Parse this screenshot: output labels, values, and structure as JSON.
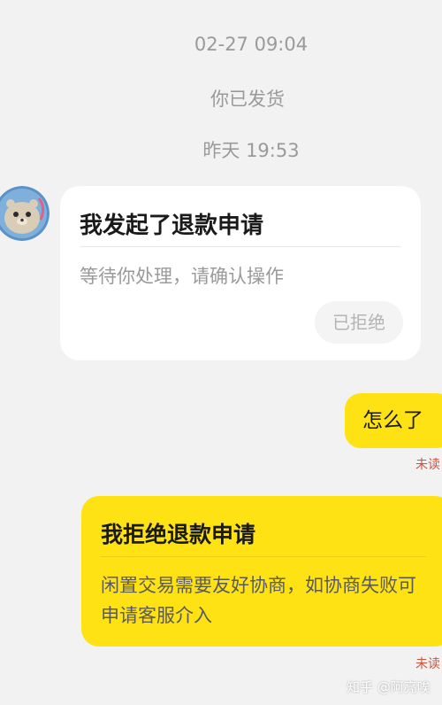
{
  "timestamps": [
    "02-27 09:04",
    "你已发货",
    "昨天 19:53"
  ],
  "refund_card": {
    "title": "我发起了退款申请",
    "subtitle": "等待你处理，请确认操作",
    "status": "已拒绝"
  },
  "message": {
    "text": "怎么了",
    "read_status": "未读"
  },
  "reject_card": {
    "title": "我拒绝退款申请",
    "body": "闲置交易需要友好协商，如协商失败可申请客服介入",
    "read_status": "未读"
  },
  "watermark": "知乎 @阿亮唉",
  "colors": {
    "background": "#f2f2f2",
    "accent_yellow": "#ffe214",
    "unread_red": "#c9553c"
  },
  "icons": {
    "avatar": "seal-avatar-icon"
  }
}
